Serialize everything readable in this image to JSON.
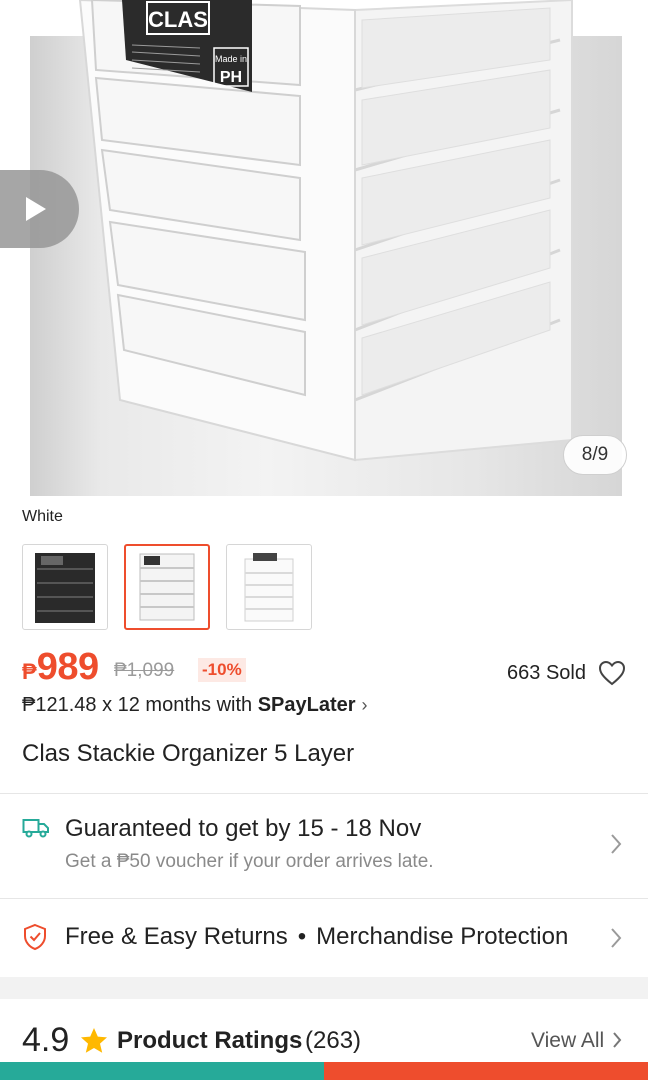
{
  "gallery": {
    "counter": "8/9",
    "brand_label": "CLAS",
    "made_in_label": "Made in",
    "made_in_country": "PH"
  },
  "variation": {
    "selected_label": "White",
    "options": [
      "Black",
      "White",
      "Clear"
    ]
  },
  "price": {
    "currency": "₱",
    "current": "989",
    "original": "₱1,099",
    "discount": "-10%",
    "sold": "663 Sold"
  },
  "installment": {
    "text": "₱121.48 x 12 months with ",
    "provider": "SPayLater"
  },
  "product": {
    "title": "Clas Stackie Organizer 5 Layer"
  },
  "shipping": {
    "title": "Guaranteed to get by 15 - 18 Nov",
    "subtitle": "Get a ₱50 voucher if your order arrives late."
  },
  "returns": {
    "item1": "Free & Easy Returns",
    "separator": "•",
    "item2": "Merchandise Protection"
  },
  "ratings": {
    "score": "4.9",
    "label": "Product Ratings",
    "count": "(263)",
    "view_all": "View All"
  },
  "colors": {
    "brand_orange": "#ee4d2d",
    "teal": "#26aa99"
  },
  "icons": [
    "play-icon",
    "heart-icon",
    "truck-icon",
    "shield-icon",
    "star-icon",
    "chevron-right-icon"
  ]
}
